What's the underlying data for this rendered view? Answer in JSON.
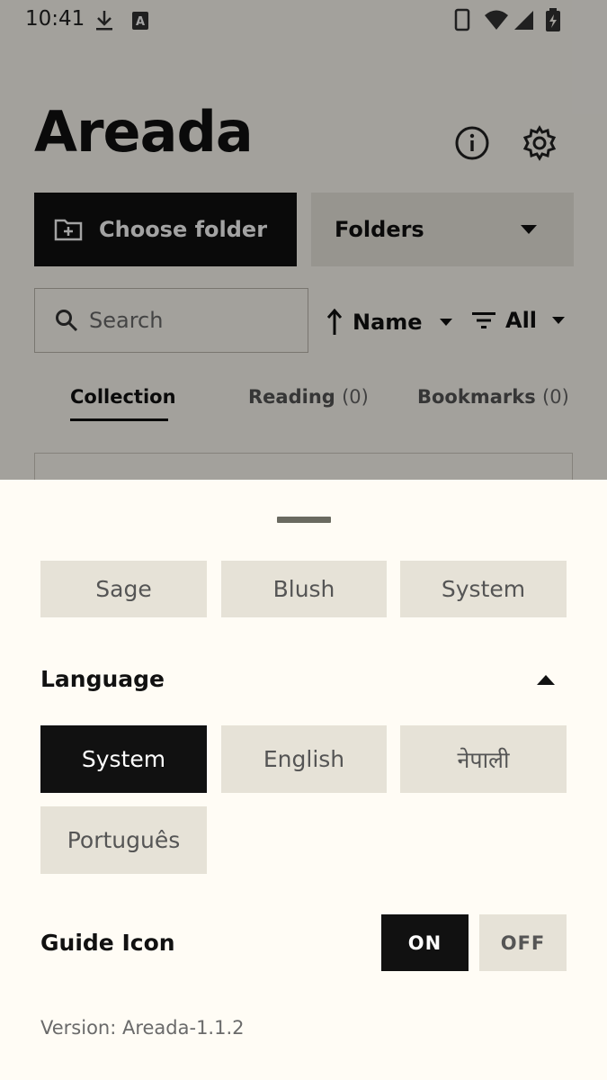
{
  "status_bar": {
    "time": "10:41"
  },
  "app": {
    "title": "Areada",
    "choose_folder_label": "Choose folder",
    "folders_dropdown_value": "Folders",
    "search_placeholder": "Search",
    "sort_label": "Name",
    "filter_label": "All"
  },
  "tabs": [
    {
      "label": "Collection",
      "count": ""
    },
    {
      "label": "Reading",
      "count": "(0)"
    },
    {
      "label": "Bookmarks",
      "count": "(0)"
    }
  ],
  "sheet": {
    "theme_options": [
      "Sage",
      "Blush",
      "System"
    ],
    "language_heading": "Language",
    "language_options": [
      "System",
      "English",
      "नेपाली",
      "Português"
    ],
    "language_selected": "System",
    "guide_icon_label": "Guide Icon",
    "guide_on": "ON",
    "guide_off": "OFF",
    "guide_selected": "ON",
    "version_text": "Version: Areada-1.1.2"
  },
  "colors": {
    "accent": "#111111",
    "chip": "#e6e2d7",
    "sheet": "#fffcf5"
  }
}
